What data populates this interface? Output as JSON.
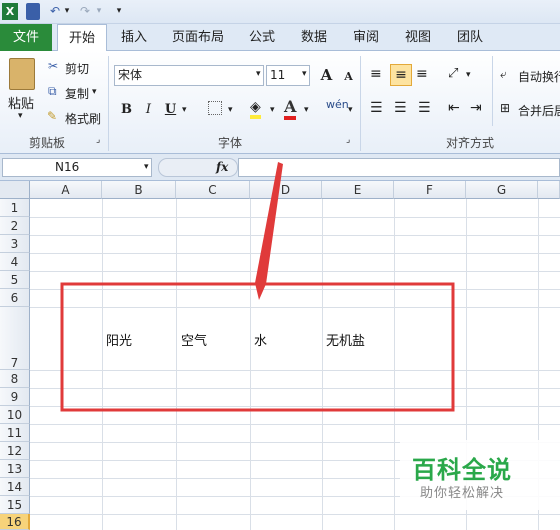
{
  "quick_access": {
    "undo_arrow": "▾",
    "redo_arrow": "▾",
    "customize": "▾"
  },
  "tabs": [
    {
      "label": "文件"
    },
    {
      "label": "开始"
    },
    {
      "label": "插入"
    },
    {
      "label": "页面布局"
    },
    {
      "label": "公式"
    },
    {
      "label": "数据"
    },
    {
      "label": "审阅"
    },
    {
      "label": "视图"
    },
    {
      "label": "团队"
    }
  ],
  "clipboard": {
    "paste": "粘贴",
    "cut": "剪切",
    "copy": "复制",
    "format_painter": "格式刷",
    "group": "剪贴板"
  },
  "font": {
    "name": "宋体",
    "size": "11",
    "bold": "B",
    "italic": "I",
    "underline": "U",
    "grow": "A",
    "shrink": "A",
    "group": "字体",
    "wen": "wén"
  },
  "alignment": {
    "wrap": "自动换行",
    "merge": "合并后居",
    "group": "对齐方式"
  },
  "name_box": "N16",
  "fx": "fx",
  "columns": [
    "A",
    "B",
    "C",
    "D",
    "E",
    "F",
    "G"
  ],
  "rows": [
    "1",
    "2",
    "3",
    "4",
    "5",
    "6",
    "7",
    "8",
    "9",
    "10",
    "11",
    "12",
    "13",
    "14",
    "15",
    "16"
  ],
  "cells": {
    "b7": "阳光",
    "c7": "空气",
    "d7": "水",
    "e7": "无机盐"
  },
  "watermark": {
    "title": "百科全说",
    "subtitle": "助你轻松解决"
  },
  "colors": {
    "annotation": "#e03a3a",
    "file_tab": "#2a8b3a",
    "watermark": "#2aa84a"
  }
}
